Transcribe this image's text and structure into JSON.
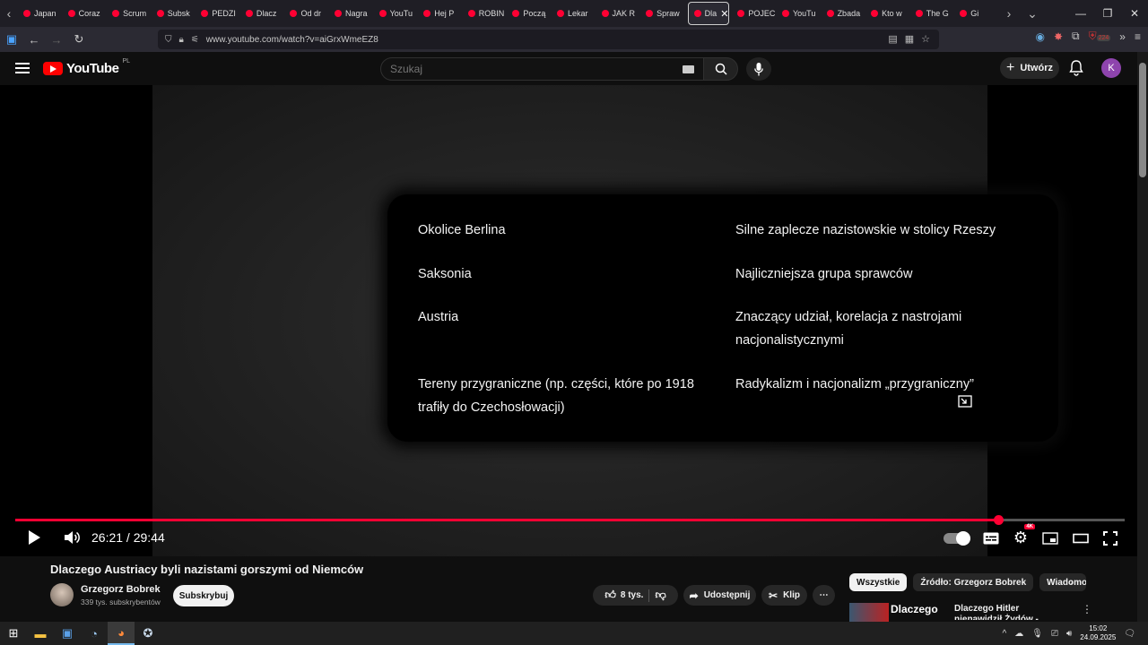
{
  "browser": {
    "tabs": [
      {
        "label": "Japan"
      },
      {
        "label": "Coraz"
      },
      {
        "label": "Scrum"
      },
      {
        "label": "Subsk"
      },
      {
        "label": "PEDZI"
      },
      {
        "label": "Dlacz"
      },
      {
        "label": "Od dr"
      },
      {
        "label": "Nagra"
      },
      {
        "label": "YouTu"
      },
      {
        "label": "Hej P"
      },
      {
        "label": "ROBIN"
      },
      {
        "label": "Począ"
      },
      {
        "label": "Lekar"
      },
      {
        "label": "JAK R"
      },
      {
        "label": "Spraw"
      },
      {
        "label": "Dla",
        "active": true
      },
      {
        "label": "POJEC"
      },
      {
        "label": "YouTu"
      },
      {
        "label": "Zbada"
      },
      {
        "label": "Kto w"
      },
      {
        "label": "The G"
      },
      {
        "label": "Gi"
      }
    ],
    "url": "www.youtube.com/watch?v=aiGrxWmeEZ8",
    "extension_badge": "224"
  },
  "yt_header": {
    "logo_text": "YouTube",
    "country_code": "PL",
    "search_placeholder": "Szukaj",
    "create_label": "Utwórz",
    "avatar_letter": "K"
  },
  "slide": {
    "rows": [
      {
        "left": "Okolice Berlina",
        "right": "Silne zaplecze nazistowskie w stolicy Rzeszy"
      },
      {
        "left": "Saksonia",
        "right": "Najliczniejsza grupa sprawców"
      },
      {
        "left": "Austria",
        "right": "Znaczący udział, korelacja z nastrojami nacjonalistycznymi"
      },
      {
        "left": "Tereny przygraniczne (np. części, które po 1918 trafiły do Czechosłowacji)",
        "right": "Radykalizm i nacjonalizm „przygraniczny”"
      }
    ]
  },
  "player": {
    "current_time": "26:21",
    "duration": "29:44",
    "time_display": "26:21 / 29:44",
    "progress_fraction": 0.8862,
    "quality_badge": "4K"
  },
  "video": {
    "title": "Dlaczego Austriacy byli nazistami gorszymi od Niemców",
    "channel_name": "Grzegorz Bobrek",
    "subscribers": "339 tys. subskrybentów",
    "subscribe_label": "Subskrybuj",
    "likes": "8 tys.",
    "share_label": "Udostępnij",
    "clip_label": "Klip"
  },
  "chips": [
    {
      "label": "Wszystkie",
      "active": true
    },
    {
      "label": "Źródło: Grzegorz Bobrek"
    },
    {
      "label": "Wiadomo"
    }
  ],
  "recommendation": {
    "thumb_text": "Dlaczego Hitler",
    "title": "Dlaczego Hitler nienawidził Żydów - kulisy obsesji"
  },
  "taskbar": {
    "time": "15:02",
    "date": "24.09.2025"
  },
  "colors": {
    "accent": "#ff0033",
    "background": "#0f0f0f",
    "avatar": "#8e44ad"
  }
}
